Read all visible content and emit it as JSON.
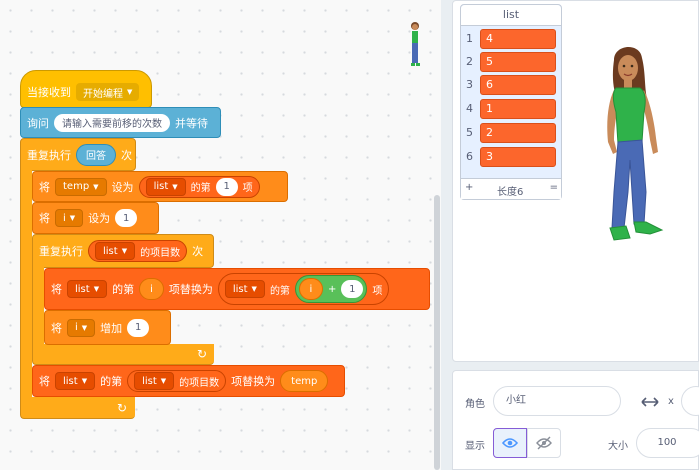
{
  "blocks": {
    "when_received": "当接收到",
    "broadcast": "开始编程",
    "ask": "询问",
    "ask_prompt": "请输入需要前移的次数",
    "and_wait": "并等待",
    "repeat": "重复执行",
    "answer": "回答",
    "times": "次",
    "set_word": "将",
    "temp_var": "temp",
    "set_to": "设为",
    "list_name": "list",
    "item_of": "的第",
    "item_suffix": "项",
    "one": "1",
    "i_var": "i",
    "length_of": "的项目数",
    "replace_with": "项替换为",
    "plus": "+",
    "change_by": "增加",
    "dropdown_caret": "▼",
    "loop_arrow": "↻"
  },
  "stage": {
    "list_monitor": {
      "title": "list",
      "items": [
        {
          "index": "1",
          "value": "4"
        },
        {
          "index": "2",
          "value": "5"
        },
        {
          "index": "3",
          "value": "6"
        },
        {
          "index": "4",
          "value": "1"
        },
        {
          "index": "5",
          "value": "2"
        },
        {
          "index": "6",
          "value": "3"
        }
      ],
      "add": "+",
      "length_label": "长度6",
      "resize": "="
    }
  },
  "sprite_info": {
    "sprite_label": "角色",
    "sprite_name": "小红",
    "x_label": "x",
    "show_label": "显示",
    "size_label": "大小",
    "size_value": "100"
  }
}
